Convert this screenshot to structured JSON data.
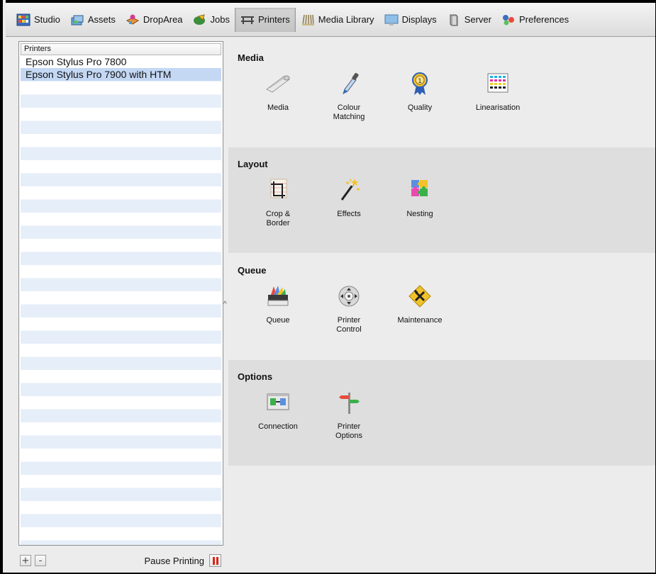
{
  "toolbar": {
    "items": [
      {
        "label": "Studio",
        "icon": "studio-icon"
      },
      {
        "label": "Assets",
        "icon": "assets-icon"
      },
      {
        "label": "DropArea",
        "icon": "droparea-icon"
      },
      {
        "label": "Jobs",
        "icon": "jobs-icon"
      },
      {
        "label": "Printers",
        "icon": "printers-icon",
        "active": true
      },
      {
        "label": "Media Library",
        "icon": "media-library-icon"
      },
      {
        "label": "Displays",
        "icon": "displays-icon"
      },
      {
        "label": "Server",
        "icon": "server-icon"
      },
      {
        "label": "Preferences",
        "icon": "preferences-icon"
      }
    ]
  },
  "printers": {
    "header": "Printers",
    "items": [
      {
        "name": "Epson Stylus Pro 7800",
        "selected": false
      },
      {
        "name": "Epson Stylus Pro 7900 with HTM",
        "selected": true
      }
    ]
  },
  "bottom": {
    "add_label": "+",
    "remove_label": "-",
    "pause_label": "Pause Printing",
    "pause_icon": "pause-icon",
    "pause_color": "#d9251c"
  },
  "sections": {
    "media": {
      "title": "Media",
      "tools": [
        {
          "label": "Media",
          "icon": "media-roll-icon"
        },
        {
          "label": "Colour\nMatching",
          "icon": "eyedropper-icon"
        },
        {
          "label": "Quality",
          "icon": "award-ribbon-icon"
        },
        {
          "label": "Linearisation",
          "icon": "color-grid-icon"
        }
      ]
    },
    "layout": {
      "title": "Layout",
      "tools": [
        {
          "label": "Crop &\nBorder",
          "icon": "crop-icon"
        },
        {
          "label": "Effects",
          "icon": "magic-wand-icon"
        },
        {
          "label": "Nesting",
          "icon": "puzzle-icon"
        }
      ]
    },
    "queue": {
      "title": "Queue",
      "tools": [
        {
          "label": "Queue",
          "icon": "print-queue-icon"
        },
        {
          "label": "Printer\nControl",
          "icon": "control-wheel-icon"
        },
        {
          "label": "Maintenance",
          "icon": "tools-sign-icon"
        }
      ]
    },
    "options": {
      "title": "Options",
      "tools": [
        {
          "label": "Connection",
          "icon": "connection-icon"
        },
        {
          "label": "Printer\nOptions",
          "icon": "signpost-icon"
        }
      ]
    }
  },
  "colors": {
    "selection": "#c4d8f4",
    "stripe": "#e6eef9",
    "section_shade": "#dedede"
  }
}
